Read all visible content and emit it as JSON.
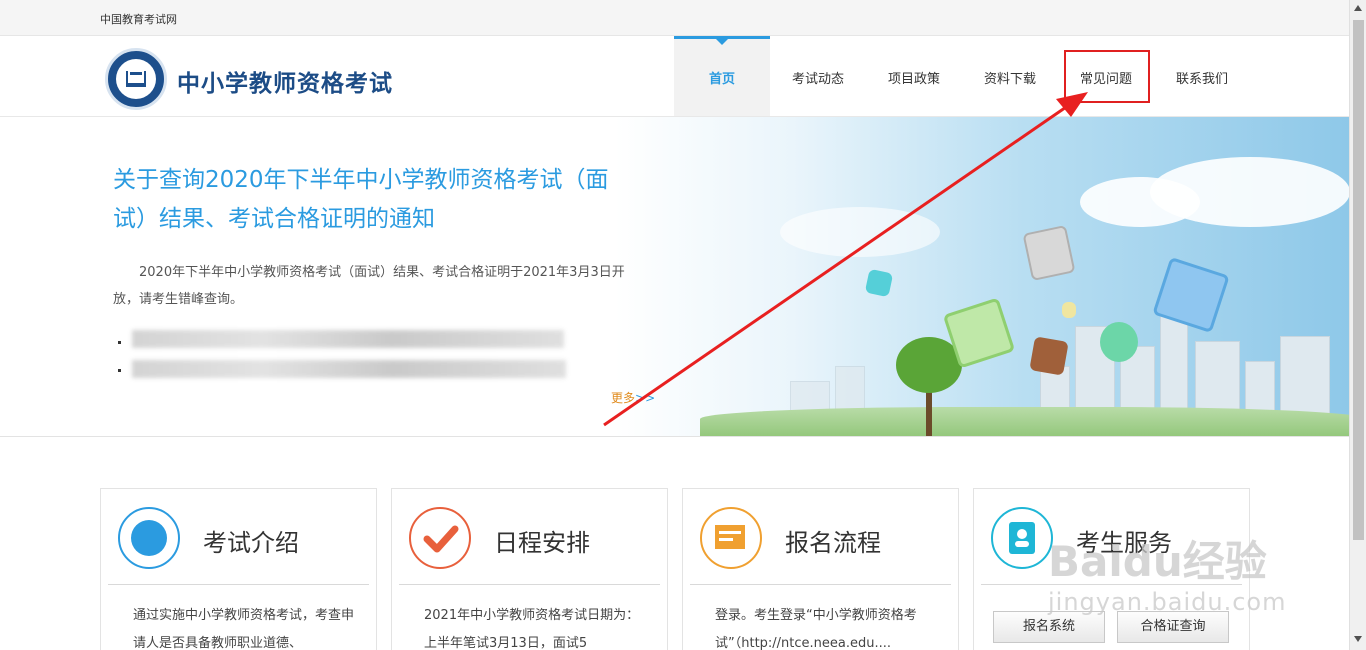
{
  "topbar": {
    "site_name": "中国教育考试网"
  },
  "header": {
    "brand": "中小学教师资格考试",
    "nav": [
      "首页",
      "考试动态",
      "项目政策",
      "资料下载",
      "常见问题",
      "联系我们"
    ],
    "active_index": 0,
    "highlighted_item": "常见问题"
  },
  "banner": {
    "headline": "关于查询2020年下半年中小学教师资格考试（面试）结果、考试合格证明的通知",
    "description": "2020年下半年中小学教师资格考试（面试）结果、考试合格证明于2021年3月3日开放，请考生错峰查询。",
    "more_label": "更多",
    "more_arrow": ">>"
  },
  "cards": [
    {
      "title": "考试介绍",
      "text": "通过实施中小学教师资格考试，考查申请人是否具备教师职业道德、",
      "icon": "document-icon",
      "color": "#2b9be0"
    },
    {
      "title": "日程安排",
      "text": "2021年中小学教师资格考试日期为：上半年笔试3月13日，面试5",
      "icon": "check-icon",
      "color": "#e8603c"
    },
    {
      "title": "报名流程",
      "text": "登录。考生登录“中小学教师资格考试”（http://ntce.neea.edu....",
      "icon": "form-icon",
      "color": "#f0a030"
    },
    {
      "title": "考生服务",
      "icon": "contacts-icon",
      "color": "#1eb6d6",
      "buttons": [
        "报名系统",
        "合格证查询"
      ]
    }
  ],
  "watermark": {
    "line1": "Baidu经验",
    "line2": "jingyan.baidu.com"
  },
  "colors": {
    "accent": "#2b9be0",
    "brand": "#1c4c86",
    "annotation_red": "#e02020"
  }
}
